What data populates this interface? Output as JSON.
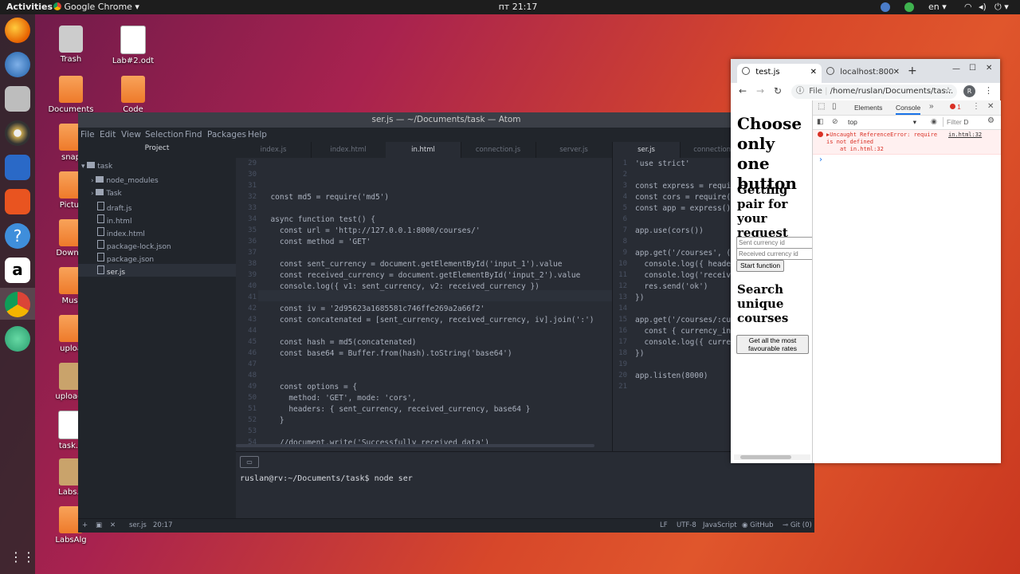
{
  "topbar": {
    "activities": "Activities",
    "app": "Google Chrome",
    "clock": "пт 21:17",
    "lang": "en"
  },
  "desktop": {
    "icons": [
      "Trash",
      "Lab#2.odt",
      "Documents",
      "Code",
      "snap",
      "Pictur",
      "Downlo",
      "Musi",
      "uploa",
      "uploads",
      "task.o",
      "Labs.z",
      "LabsAlg"
    ]
  },
  "atom": {
    "title": "ser.js — ~/Documents/task — Atom",
    "menu": [
      "File",
      "Edit",
      "View",
      "Selection",
      "Find",
      "Packages",
      "Help"
    ],
    "tree": {
      "header": "Project",
      "items": [
        "task",
        "node_modules",
        "Task",
        "draft.js",
        "in.html",
        "index.html",
        "package-lock.json",
        "package.json",
        "ser.js"
      ]
    },
    "tabs_left": [
      "index.js",
      "index.html",
      "in.html",
      "connection.js",
      "server.js"
    ],
    "tabs_right": [
      "ser.js",
      "connection."
    ],
    "left_lines": [
      [
        "29",
        ""
      ],
      [
        "30",
        ""
      ],
      [
        "31",
        ""
      ],
      [
        "32",
        "  const md5 = require('md5')"
      ],
      [
        "33",
        ""
      ],
      [
        "34",
        "  async function test() {"
      ],
      [
        "35",
        "    const url = 'http://127.0.0.1:8000/courses/'"
      ],
      [
        "36",
        "    const method = 'GET'"
      ],
      [
        "37",
        ""
      ],
      [
        "38",
        "    const sent_currency = document.getElementById('input_1').value"
      ],
      [
        "39",
        "    const received_currency = document.getElementById('input_2').value"
      ],
      [
        "40",
        "    console.log({ v1: sent_currency, v2: received_currency })"
      ],
      [
        "41",
        ""
      ],
      [
        "42",
        "    const iv = '2d95623a1685581c746ffe269a2a66f2'"
      ],
      [
        "43",
        "    const concatenated = [sent_currency, received_currency, iv].join(':')"
      ],
      [
        "44",
        ""
      ],
      [
        "45",
        "    const hash = md5(concatenated)"
      ],
      [
        "46",
        "    const base64 = Buffer.from(hash).toString('base64')"
      ],
      [
        "47",
        ""
      ],
      [
        "48",
        ""
      ],
      [
        "49",
        "    const options = {"
      ],
      [
        "50",
        "      method: 'GET', mode: 'cors',"
      ],
      [
        "51",
        "      headers: { sent_currency, received_currency, base64 }"
      ],
      [
        "52",
        "    }"
      ],
      [
        "53",
        ""
      ],
      [
        "54",
        "    //document.write('Successfully received data')"
      ]
    ],
    "right_lines": [
      [
        "1",
        "'use strict'"
      ],
      [
        "2",
        ""
      ],
      [
        "3",
        "const express = requi"
      ],
      [
        "4",
        "const cors = require("
      ],
      [
        "5",
        "const app = express()"
      ],
      [
        "6",
        ""
      ],
      [
        "7",
        "app.use(cors())"
      ],
      [
        "8",
        ""
      ],
      [
        "9",
        "app.get('/courses', ("
      ],
      [
        "10",
        "  console.log({ heade"
      ],
      [
        "11",
        "  console.log('receiv"
      ],
      [
        "12",
        "  res.send('ok')"
      ],
      [
        "13",
        "})"
      ],
      [
        "14",
        ""
      ],
      [
        "15",
        "app.get('/courses/:cu"
      ],
      [
        "16",
        "  const { currency_in"
      ],
      [
        "17",
        "  console.log({ curre"
      ],
      [
        "18",
        "})"
      ],
      [
        "19",
        ""
      ],
      [
        "20",
        "app.listen(8000)"
      ],
      [
        "21",
        ""
      ]
    ],
    "terminal": "ruslan@rv:~/Documents/task$ node ser",
    "status": {
      "file": "ser.js",
      "pos": "20:17",
      "lf": "LF",
      "enc": "UTF-8",
      "lang": "JavaScript",
      "github": "GitHub",
      "git": "Git (0)"
    }
  },
  "chrome": {
    "tab1": "test.js",
    "tab2": "localhost:800",
    "file_label": "File",
    "url": "/home/ruslan/Documents/tas...",
    "avatar": "R",
    "page": {
      "h1": "Choose only one button",
      "h2a": "Getting pair for your request",
      "input1": "Sent currency id",
      "input2": "Received currency id",
      "btn1": "Start function",
      "h2b": "Search unique courses",
      "btn2": "Get all the most favourable rates"
    },
    "devtools": {
      "tab_elements": "Elements",
      "tab_console": "Console",
      "more": "»",
      "err_count": "1",
      "context": "top",
      "filter": "Filter",
      "d": "D",
      "error_msg": "▶Uncaught ReferenceError: require is not defined",
      "error_at": "at in.html:32",
      "error_link": "in.html:32",
      "prompt": "›"
    }
  }
}
